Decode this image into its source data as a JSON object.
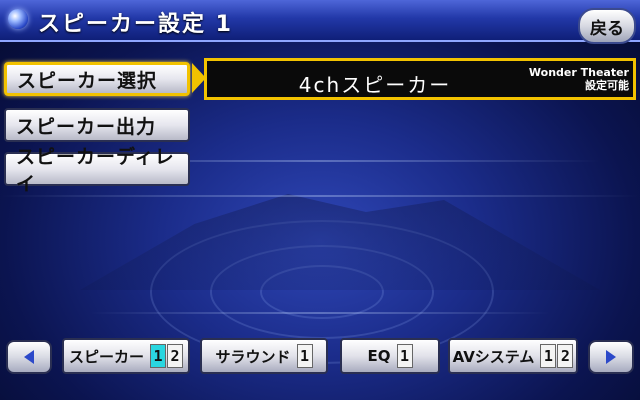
{
  "header": {
    "title": "スピーカー設定 1",
    "back_label": "戻る"
  },
  "menu": {
    "items": [
      {
        "label": "スピーカー選択",
        "active": true
      },
      {
        "label": "スピーカー出力",
        "active": false
      },
      {
        "label": "スピーカーディレイ",
        "active": false
      }
    ]
  },
  "panel": {
    "value": "4chスピーカー",
    "note_line1": "Wonder Theater",
    "note_line2": "設定可能"
  },
  "nav": {
    "tabs": [
      {
        "label": "スピーカー",
        "pages": [
          "1",
          "2"
        ],
        "active_page": 0
      },
      {
        "label": "サラウンド",
        "pages": [
          "1"
        ]
      },
      {
        "label": "EQ",
        "pages": [
          "1"
        ]
      },
      {
        "label": "AVシステム",
        "pages": [
          "1",
          "2"
        ]
      }
    ]
  },
  "colors": {
    "accent": "#f2c200",
    "active_page": "#2ad6e0",
    "header": "#2238a8"
  },
  "icons": {
    "prev": "triangle-left-icon",
    "next": "triangle-right-icon",
    "title": "orb-icon"
  }
}
